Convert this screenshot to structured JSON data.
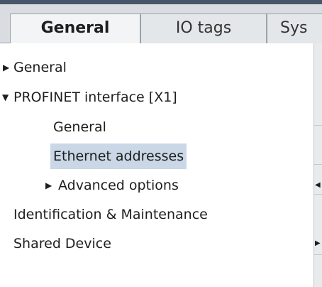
{
  "tabs": [
    {
      "label": "General",
      "active": true
    },
    {
      "label": "IO tags",
      "active": false
    },
    {
      "label": "Sys",
      "active": false
    }
  ],
  "tree": {
    "items": [
      {
        "label": "General",
        "arrow": "right-triangle-icon"
      },
      {
        "label": "PROFINET interface [X1]",
        "arrow": "down-triangle-icon"
      },
      {
        "label": "General"
      },
      {
        "label": "Ethernet addresses",
        "selected": true
      },
      {
        "label": "Advanced options",
        "arrow": "right-triangle-icon"
      },
      {
        "label": "Identification & Maintenance"
      },
      {
        "label": "Shared Device"
      }
    ]
  },
  "colors": {
    "top_strip": "#47566a",
    "tabbar": "#d9dde1",
    "selection": "#c9d7e6"
  }
}
